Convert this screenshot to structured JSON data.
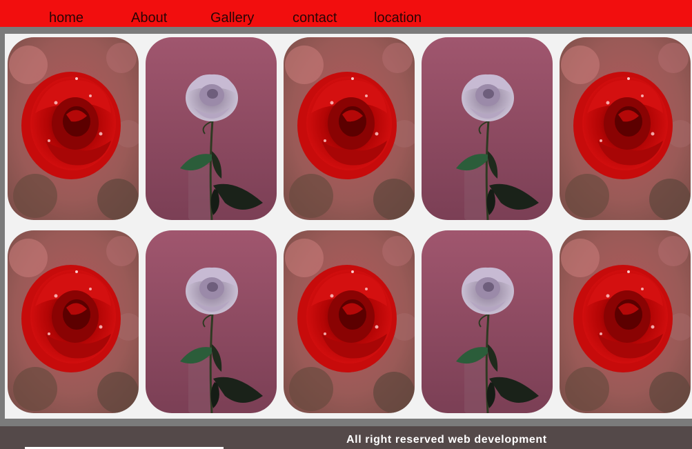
{
  "nav": {
    "items": [
      {
        "label": "home"
      },
      {
        "label": "About"
      },
      {
        "label": "Gallery"
      },
      {
        "label": "contact"
      },
      {
        "label": "location"
      }
    ]
  },
  "gallery": {
    "rows": [
      [
        "red-rose-photo",
        "lavender-rose-photo",
        "red-rose-photo",
        "lavender-rose-photo",
        "red-rose-photo"
      ],
      [
        "red-rose-photo",
        "lavender-rose-photo",
        "red-rose-photo",
        "lavender-rose-photo",
        "red-rose-photo"
      ]
    ]
  },
  "footer": {
    "text": "All right reserved web development"
  },
  "colors": {
    "nav_bg": "#f20e0e",
    "page_bg": "#7b7b7b",
    "gallery_bg": "#f2f2f2",
    "footer_bg": "#544949",
    "footer_text": "#ffffff"
  }
}
